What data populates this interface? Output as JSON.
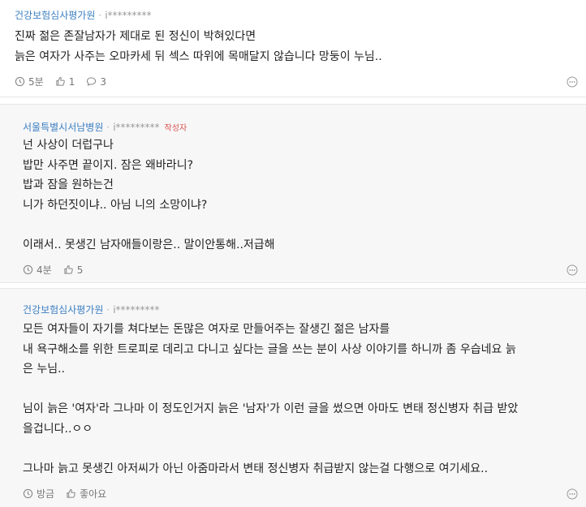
{
  "comments": [
    {
      "author": "건강보험심사평가원",
      "user_id": "i*********",
      "lines": [
        "진짜 젊은 존잘남자가 제대로 된 정신이 박혀있다면",
        "늙은 여자가 사주는 오마카세 뒤 섹스 따위에 목매달지 않습니다 망둥이 누님.."
      ],
      "time": "5분",
      "likes": "1",
      "replies": "3"
    },
    {
      "author": "서울특별시서남병원",
      "user_id": "i*********",
      "badge": "작성자",
      "lines": [
        "넌 사상이 더럽구나",
        "밥만 사주면 끝이지. 잠은 왜바라니?",
        "밥과 잠을 원하는건",
        "니가 하던짓이냐.. 아님 니의 소망이냐?",
        "",
        "이래서.. 못생긴 남자애들이랑은.. 말이안통해..저급해"
      ],
      "time": "4분",
      "likes": "5"
    },
    {
      "author": "건강보험심사평가원",
      "user_id": "i*********",
      "lines": [
        "모든 여자들이 자기를 쳐다보는 돈많은 여자로 만들어주는 잘생긴 젊은 남자를",
        "내 욕구해소를 위한 트로피로 데리고 다니고 싶다는 글을 쓰는 분이 사상 이야기를 하니까 좀 우습네요 늙",
        "은 누님..",
        "",
        "님이 늙은 '여자'라 그나마 이 정도인거지 늙은 '남자'가 이런 글을 썼으면 아마도 변태 정신병자 취급 받았",
        "을겁니다..ㅇㅇ",
        "",
        "그나마 늙고 못생긴 아저씨가 아닌 아줌마라서 변태 정신병자 취급받지 않는걸 다행으로 여기세요.."
      ],
      "time": "방금",
      "like_label": "좋아요"
    }
  ]
}
